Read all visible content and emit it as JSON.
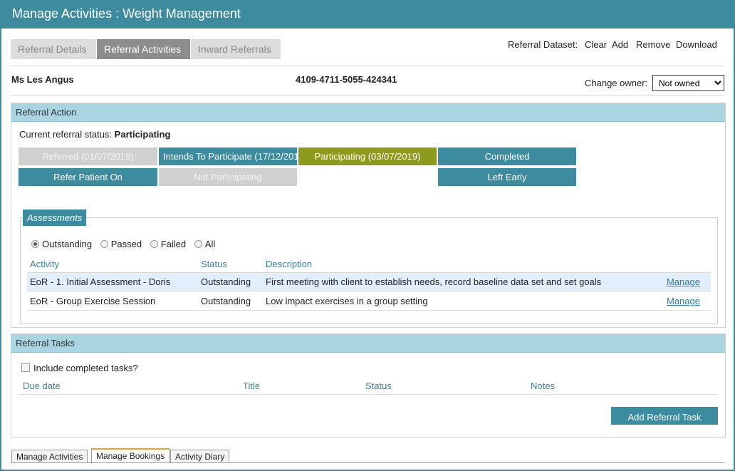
{
  "window": {
    "title": "Manage Activities : Weight Management"
  },
  "top_tabs": [
    {
      "label": "Referral Details",
      "active": false
    },
    {
      "label": "Referral Activities",
      "active": true
    },
    {
      "label": "Inward Referrals",
      "active": false
    }
  ],
  "dataset": {
    "label": "Referral Dataset:",
    "clear": "Clear",
    "add": "Add",
    "remove": "Remove",
    "download": "Download"
  },
  "patient": {
    "name": "Ms Les Angus",
    "number": "4109-4711-5055-424341"
  },
  "owner": {
    "label": "Change owner:",
    "selected": "Not owned"
  },
  "referral_action": {
    "heading": "Referral Action",
    "status_label": "Current referral status:",
    "status_value": "Participating",
    "buttons": {
      "referred": "Referred (01/07/2018)",
      "intends": "Intends To Participate (17/12/201",
      "participating": "Participating (03/07/2019)",
      "completed": "Completed",
      "refer_on": "Refer Patient On",
      "not_participating": "Not Participating",
      "left_early": "Left Early"
    }
  },
  "assessments": {
    "legend": "Assessments",
    "filters": [
      {
        "label": "Outstanding",
        "selected": true
      },
      {
        "label": "Passed",
        "selected": false
      },
      {
        "label": "Failed",
        "selected": false
      },
      {
        "label": "All",
        "selected": false
      }
    ],
    "columns": [
      "Activity",
      "Status",
      "Description"
    ],
    "rows": [
      {
        "activity": "EoR - 1. Initial Assessment - Doris",
        "status": "Outstanding",
        "description": "First meeting with client to establish needs, record baseline data set and set goals",
        "action": "Manage"
      },
      {
        "activity": "EoR - Group Exercise Session",
        "status": "Outstanding",
        "description": "Low impact exercises in a group setting",
        "action": "Manage"
      }
    ]
  },
  "referral_tasks": {
    "heading": "Referral Tasks",
    "include_completed": "Include completed tasks?",
    "columns": [
      "Due date",
      "Title",
      "Status",
      "Notes"
    ],
    "add_button": "Add Referral Task"
  },
  "bottom_tabs": [
    {
      "label": "Manage Activities",
      "active": false
    },
    {
      "label": "Manage Bookings",
      "active": true
    },
    {
      "label": "Activity Diary",
      "active": false
    }
  ],
  "colors": {
    "accent": "#3d8b9e",
    "panel_header": "#a9d4e0",
    "participating": "#8c9a1e",
    "link": "#2d7ea8"
  }
}
